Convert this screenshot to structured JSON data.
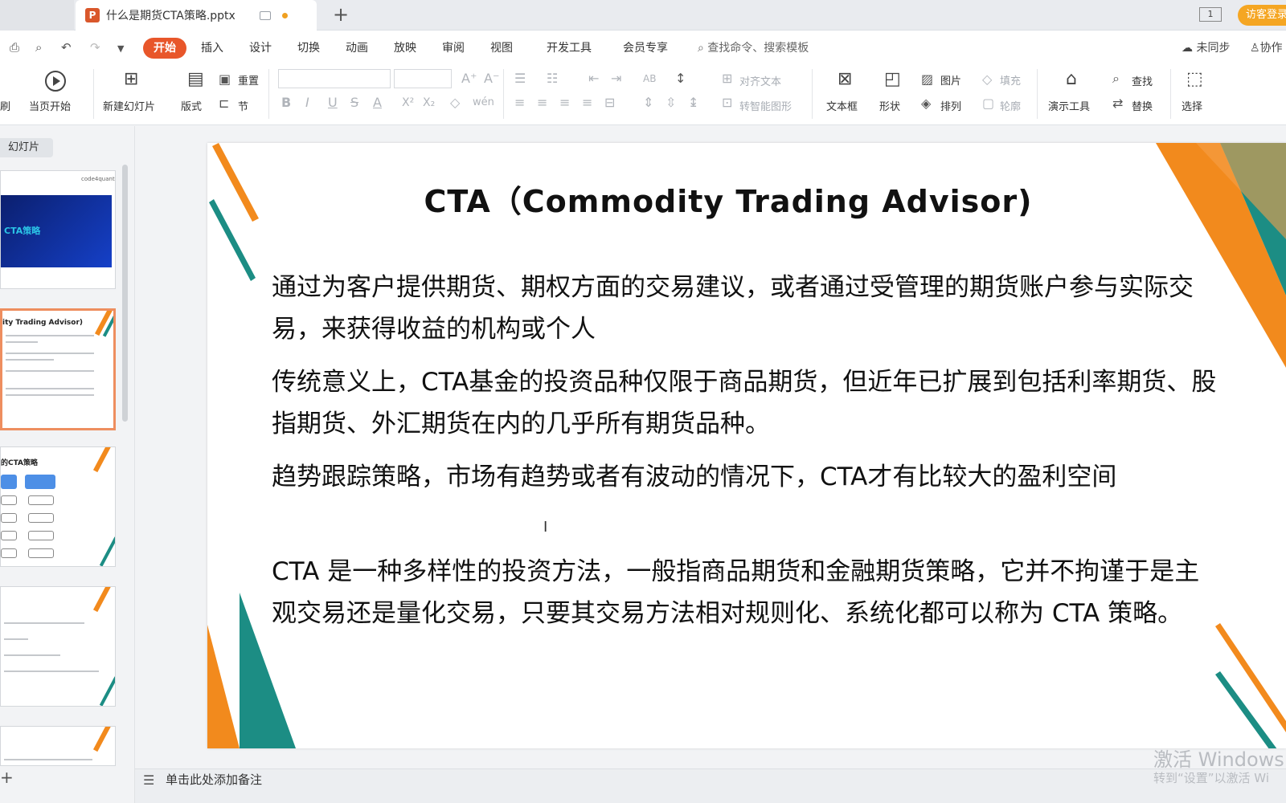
{
  "tab": {
    "filename": "什么是期货CTA策略.pptx",
    "app_letter": "P",
    "add": "+",
    "window_count": "1",
    "visitor_login": "访客登录"
  },
  "menu": {
    "start": "开始",
    "items": [
      "插入",
      "设计",
      "切换",
      "动画",
      "放映",
      "审阅",
      "视图",
      "开发工具",
      "会员专享"
    ],
    "search_placeholder": "查找命令、搜索模板",
    "unsynced": "未同步",
    "collaborate": "协作"
  },
  "ribbon": {
    "print_brush": "刷",
    "play_from_current": "当页开始",
    "new_slide": "新建幻灯片",
    "layout": "版式",
    "reset": "重置",
    "section": "节",
    "bold": "B",
    "italic": "I",
    "underline": "U",
    "strike": "S",
    "font_color": "A",
    "superscript": "X²",
    "subscript": "X₂",
    "eraser": "◇",
    "phonetic": "wén",
    "align_text": "对齐文本",
    "convert_smartart": "转智能图形",
    "textbox": "文本框",
    "shape": "形状",
    "picture": "图片",
    "arrange": "排列",
    "fill": "填充",
    "outline": "轮廓",
    "presentation_tools": "演示工具",
    "find": "查找",
    "replace": "替换",
    "select": "选择"
  },
  "panel": {
    "tab_label": "幻灯片",
    "add": "+",
    "thumb1_brand": "code4quant",
    "thumb1_title": "CTA策略",
    "thumb2_title": "ity Trading Advisor)",
    "thumb3_title": "的CTA策略"
  },
  "slide": {
    "title": "CTA（Commodity Trading Advisor)",
    "paragraphs": [
      "通过为客户提供期货、期权方面的交易建议，或者通过受管理的期货账户参与实际交易，来获得收益的机构或个人",
      "传统意义上，CTA基金的投资品种仅限于商品期货，但近年已扩展到包括利率期货、股指期货、外汇期货在内的几乎所有期货品种。",
      "趋势跟踪策略，市场有趋势或者有波动的情况下，CTA才有比较大的盈利空间",
      "CTA 是一种多样性的投资方法，一般指商品期货和金融期货策略，它并不拘谨于是主观交易还是量化交易，只要其交易方法相对规则化、系统化都可以称为 CTA 策略。"
    ],
    "cursor": "I"
  },
  "notes": {
    "placeholder": "单击此处添加备注"
  },
  "watermark": {
    "line1": "激活 Windows",
    "line2": "转到“设置”以激活 Wi"
  },
  "colors": {
    "accent_orange": "#f28a1d",
    "accent_teal": "#1c8d84",
    "start_tab": "#e8562a"
  }
}
